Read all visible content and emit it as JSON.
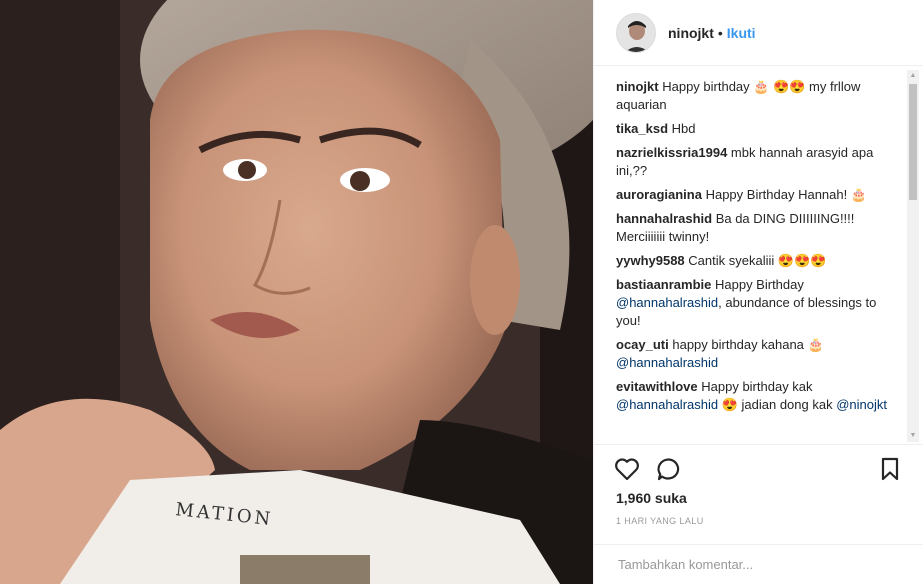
{
  "post": {
    "username": "ninojkt",
    "follow_label": "Ikuti",
    "separator": "•",
    "likes": "1,960 suka",
    "time_ago": "1 HARI YANG LALU",
    "add_comment_placeholder": "Tambahkan komentar...",
    "photo_paper_text": "MATION"
  },
  "comments": [
    {
      "user": "ninojkt",
      "text": " Happy birthday 🎂 😍😍 my frllow aquarian"
    },
    {
      "user": "tika_ksd",
      "text": " Hbd"
    },
    {
      "user": "nazrielkissria1994",
      "text": " mbk hannah arasyid apa ini,??"
    },
    {
      "user": "auroragianina",
      "text": " Happy Birthday Hannah! 🎂"
    },
    {
      "user": "hannahalrashid",
      "text": " Ba da DING DIIIIIING!!!! Merciiiiiii twinny!"
    },
    {
      "user": "yywhy9588",
      "text": " Cantik syekaliii 😍😍😍"
    },
    {
      "user": "bastiaanrambie",
      "text": " Happy Birthday ",
      "mention": "@hannahalrashid",
      "after": ", abundance of blessings to you!"
    },
    {
      "user": "ocay_uti",
      "text": " happy birthday kahana 🎂 ",
      "mention": "@hannahalrashid",
      "after": ""
    },
    {
      "user": "evitawithlove",
      "text": " Happy birthday kak ",
      "mention": "@hannahalrashid",
      "after": " 😍 jadian dong kak ",
      "mention2": "@ninojkt"
    }
  ],
  "colors": {
    "accent": "#3897f0",
    "mention": "#003569",
    "text": "#262626",
    "muted": "#999999"
  },
  "icons": {
    "like": "heart-icon",
    "comment": "speech-bubble-icon",
    "save": "bookmark-icon"
  }
}
